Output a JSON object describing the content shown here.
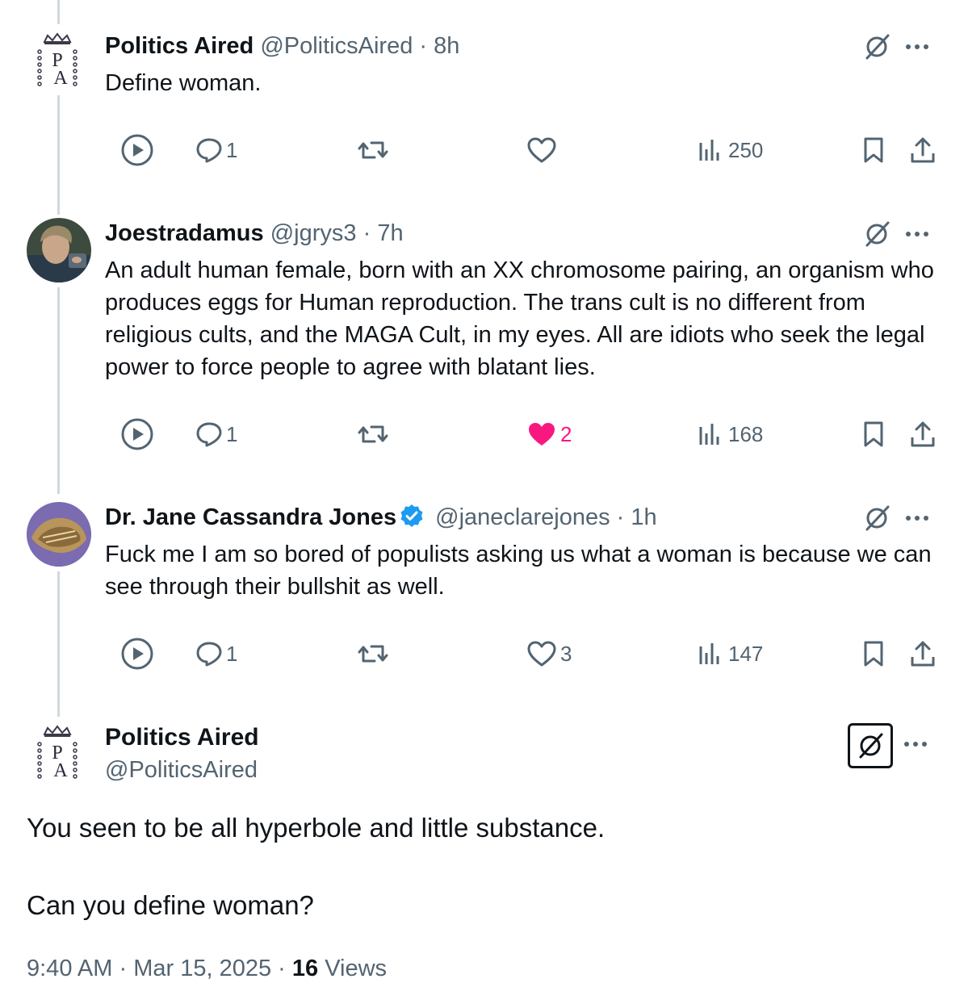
{
  "tweets": [
    {
      "name": "Politics Aired",
      "handle": "@PoliticsAired",
      "time": "8h",
      "text": "Define woman.",
      "stats": {
        "replies": "1",
        "likes": "",
        "views": "250"
      },
      "avatar": "politics-aired-logo"
    },
    {
      "name": "Joestradamus",
      "handle": "@jgrys3",
      "time": "7h",
      "text": "An adult human female, born with an XX chromosome pairing, an organism who produces eggs for Human reproduction. The trans cult is no different from religious cults, and the MAGA Cult, in my eyes. All are idiots who seek the legal power to force people to agree with blatant lies.",
      "stats": {
        "replies": "1",
        "likes": "2",
        "views": "168"
      },
      "avatar": "user-photo"
    },
    {
      "name": "Dr. Jane Cassandra Jones",
      "handle": "@janeclarejones",
      "time": "1h",
      "text": "Fuck me I am so bored of populists asking us what a woman is because we can see through their bullshit as well.",
      "stats": {
        "replies": "1",
        "likes": "3",
        "views": "147"
      },
      "avatar": "illustrated-emblem",
      "verified": true
    }
  ],
  "main": {
    "name": "Politics Aired",
    "handle": "@PoliticsAired",
    "line1": "You seen to be all hyperbole and little substance.",
    "line2": "Can you define woman?",
    "time": "9:40 AM",
    "date": "Mar 15, 2025",
    "views_count": "16",
    "views_label": "Views"
  },
  "separator": "·",
  "colors": {
    "like": "#f91880",
    "verified": "#1d9bf0",
    "muted": "#536471",
    "text": "#0f1419"
  }
}
